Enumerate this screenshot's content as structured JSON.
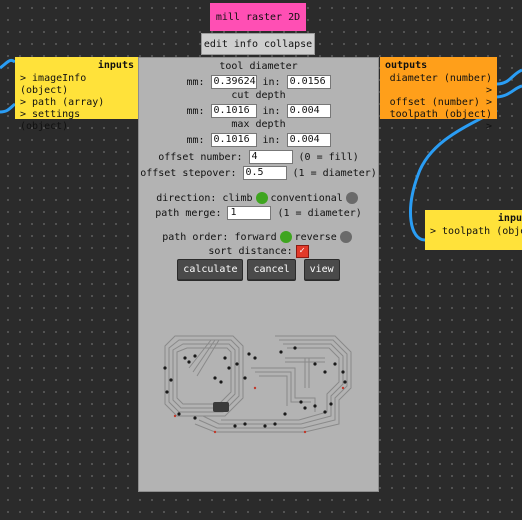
{
  "module": {
    "title": "mill raster 2D",
    "edit_label": "edit info collapse"
  },
  "inputs_node": {
    "title": "inputs",
    "ports": [
      "> imageInfo (object)",
      "> path (array)",
      "> settings (object)"
    ]
  },
  "outputs_node": {
    "title": "outputs",
    "ports": [
      "diameter (number) >",
      "offset (number) >",
      "toolpath (object) >"
    ]
  },
  "next_node": {
    "title": "inpu",
    "ports": [
      "> toolpath (objec"
    ]
  },
  "form": {
    "tool_diameter": {
      "label": "tool diameter",
      "mm_label": "mm:",
      "mm": "0.39624",
      "in_label": "in:",
      "in": "0.0156"
    },
    "cut_depth": {
      "label": "cut depth",
      "mm_label": "mm:",
      "mm": "0.1016",
      "in_label": "in:",
      "in": "0.004"
    },
    "max_depth": {
      "label": "max depth",
      "mm_label": "mm:",
      "mm": "0.1016",
      "in_label": "in:",
      "in": "0.004"
    },
    "offset_number": {
      "label": "offset number:",
      "value": "4",
      "hint": "(0 = fill)"
    },
    "offset_stepover": {
      "label": "offset stepover:",
      "value": "0.5",
      "hint": "(1 = diameter)"
    },
    "direction": {
      "label": "direction: climb",
      "alt": "conventional",
      "selected": "climb"
    },
    "path_merge": {
      "label": "path merge:",
      "value": "1",
      "hint": "(1 = diameter)"
    },
    "path_order": {
      "label": "path order: forward",
      "alt": "reverse",
      "selected": "forward"
    },
    "sort_distance": {
      "label": "sort distance:",
      "checked": true,
      "mark": "✓"
    },
    "buttons": {
      "calculate": "calculate",
      "cancel": "cancel",
      "view": "view"
    }
  },
  "colors": {
    "module_title": "#ff4fb4",
    "inputs_node": "#ffe23a",
    "outputs_node": "#ff9f1a",
    "wire": "#2a9df4",
    "radio_on": "#3ea51f"
  }
}
